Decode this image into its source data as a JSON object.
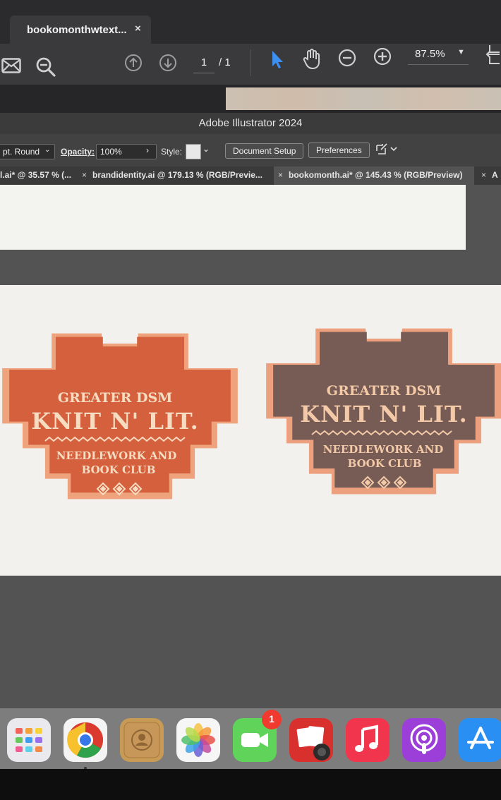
{
  "pdf_viewer": {
    "tab_title": "bookomonthwtext...",
    "tab_close": "×",
    "page_current": "1",
    "page_total": "/ 1",
    "zoom": "87.5%"
  },
  "illustrator": {
    "app_title": "Adobe Illustrator 2024",
    "control_bar": {
      "stroke_profile": "pt. Round",
      "opacity_label": "Opacity:",
      "opacity_value": "100%",
      "style_label": "Style:",
      "document_setup": "Document Setup",
      "preferences": "Preferences"
    },
    "doc_tabs": [
      {
        "label": "l.ai* @ 35.57 % (..."
      },
      {
        "label": "brandidentity.ai @ 179.13 % (RGB/Previe..."
      },
      {
        "label": "bookomonth.ai* @ 145.43 % (RGB/Preview)"
      },
      {
        "label": "A"
      }
    ],
    "tab_close": "×"
  },
  "badges": [
    {
      "line1": "GREATER DSM",
      "line2": "KNIT N' LIT.",
      "line3": "NEEDLEWORK AND",
      "line4": "BOOK CLUB",
      "fill": "#d4603e",
      "outline": "#eea37c",
      "text_color": "#f6dcc0"
    },
    {
      "line1": "GREATER DSM",
      "line2": "KNIT N' LIT.",
      "line3": "NEEDLEWORK AND",
      "line4": "BOOK CLUB",
      "fill": "#775c55",
      "outline": "#eca07e",
      "text_color": "#f3c9a7"
    }
  ],
  "dock": {
    "apps": [
      "launchpad-icon",
      "chrome-icon",
      "contacts-icon",
      "photos-icon",
      "facetime-icon",
      "photo-booth-icon",
      "music-icon",
      "podcasts-icon",
      "app-store-icon"
    ],
    "facetime_badge": "1"
  },
  "colors": {
    "accent_blue": "#3d8ff0",
    "artboard": "#f2f1ed",
    "canvas": "#535353"
  }
}
